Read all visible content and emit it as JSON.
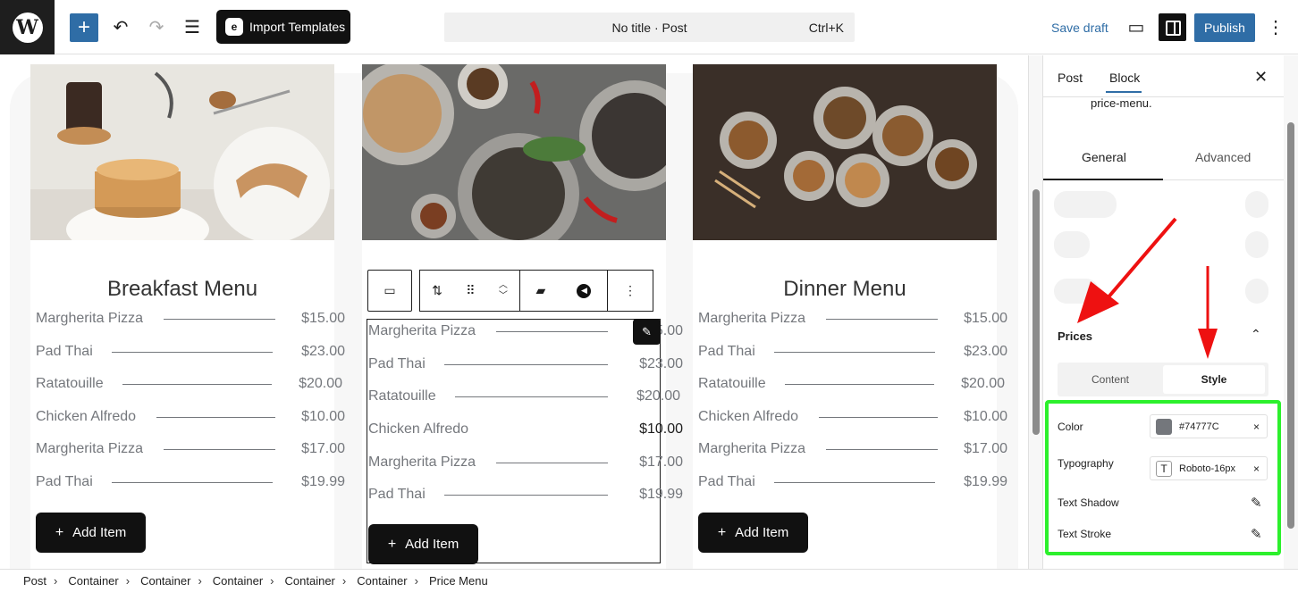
{
  "topbar": {
    "title": "No title · Post",
    "shortcut": "Ctrl+K",
    "import_label": "Import Templates",
    "save_draft": "Save draft",
    "publish": "Publish",
    "add_icon": "+",
    "undo_icon": "↶",
    "redo_icon": "↷",
    "list_icon": "☰",
    "desktop_icon": "▭",
    "more_icon": "⋮"
  },
  "cards": [
    {
      "title": "Breakfast Menu",
      "items": [
        {
          "name": "Margherita Pizza",
          "price": "$15.00"
        },
        {
          "name": "Pad Thai",
          "price": "$23.00"
        },
        {
          "name": "Ratatouille",
          "price": "$20.00"
        },
        {
          "name": "Chicken Alfredo",
          "price": "$10.00"
        },
        {
          "name": "Margherita Pizza",
          "price": "$17.00"
        },
        {
          "name": "Pad Thai",
          "price": "$19.99"
        }
      ],
      "add_label": "Add Item"
    },
    {
      "title": "",
      "items": [
        {
          "name": "Margherita Pizza",
          "price": "$15.00"
        },
        {
          "name": "Pad Thai",
          "price": "$23.00"
        },
        {
          "name": "Ratatouille",
          "price": "$20.00"
        },
        {
          "name": "Chicken Alfredo",
          "price": "$10.00"
        },
        {
          "name": "Margherita Pizza",
          "price": "$17.00"
        },
        {
          "name": "Pad Thai",
          "price": "$19.99"
        }
      ],
      "add_label": "Add Item"
    },
    {
      "title": "Dinner Menu",
      "items": [
        {
          "name": "Margherita Pizza",
          "price": "$15.00"
        },
        {
          "name": "Pad Thai",
          "price": "$23.00"
        },
        {
          "name": "Ratatouille",
          "price": "$20.00"
        },
        {
          "name": "Chicken Alfredo",
          "price": "$10.00"
        },
        {
          "name": "Margherita Pizza",
          "price": "$17.00"
        },
        {
          "name": "Pad Thai",
          "price": "$19.99"
        }
      ],
      "add_label": "Add Item"
    }
  ],
  "panel": {
    "tab_post": "Post",
    "tab_block": "Block",
    "close": "✕",
    "desc": "price-menu.",
    "tab_general": "General",
    "tab_advanced": "Advanced",
    "prices_header": "Prices",
    "seg_content": "Content",
    "seg_style": "Style",
    "color_label": "Color",
    "color_value": "#74777C",
    "typography_label": "Typography",
    "typography_value": "Roboto-16px",
    "text_shadow_label": "Text Shadow",
    "text_stroke_label": "Text Stroke",
    "chevron_icon": "⌃",
    "x_icon": "×",
    "pencil_icon": "✎"
  },
  "colors": {
    "accent": "#2F6DA6",
    "price_color": "#74777C",
    "highlight": "#2CF02C",
    "arrow": "#EE1111"
  },
  "breadcrumbs": [
    "Post",
    "Container",
    "Container",
    "Container",
    "Container",
    "Container",
    "Price Menu"
  ]
}
